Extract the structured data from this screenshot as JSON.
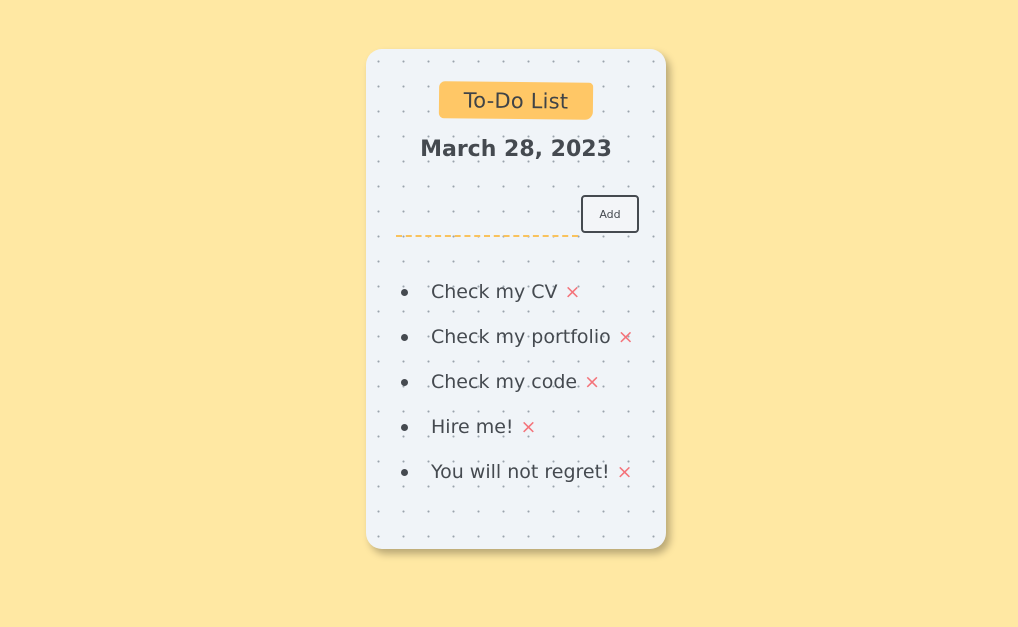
{
  "app": {
    "title": "To-Do List",
    "date": "March 28, 2023"
  },
  "input": {
    "value": "",
    "placeholder": ""
  },
  "add_button": {
    "label": "Add"
  },
  "tasks": [
    {
      "text": "Check my CV"
    },
    {
      "text": "Check my portfolio"
    },
    {
      "text": "Check my code"
    },
    {
      "text": "Hire me!"
    },
    {
      "text": "You will not regret!"
    }
  ],
  "delete_glyph": "×",
  "colors": {
    "background": "#ffe8a3",
    "card": "#f0f4f8",
    "title_tag": "#ffc766",
    "text": "#454a50",
    "delete": "#f4737a",
    "input_underline": "#f9c25d"
  }
}
